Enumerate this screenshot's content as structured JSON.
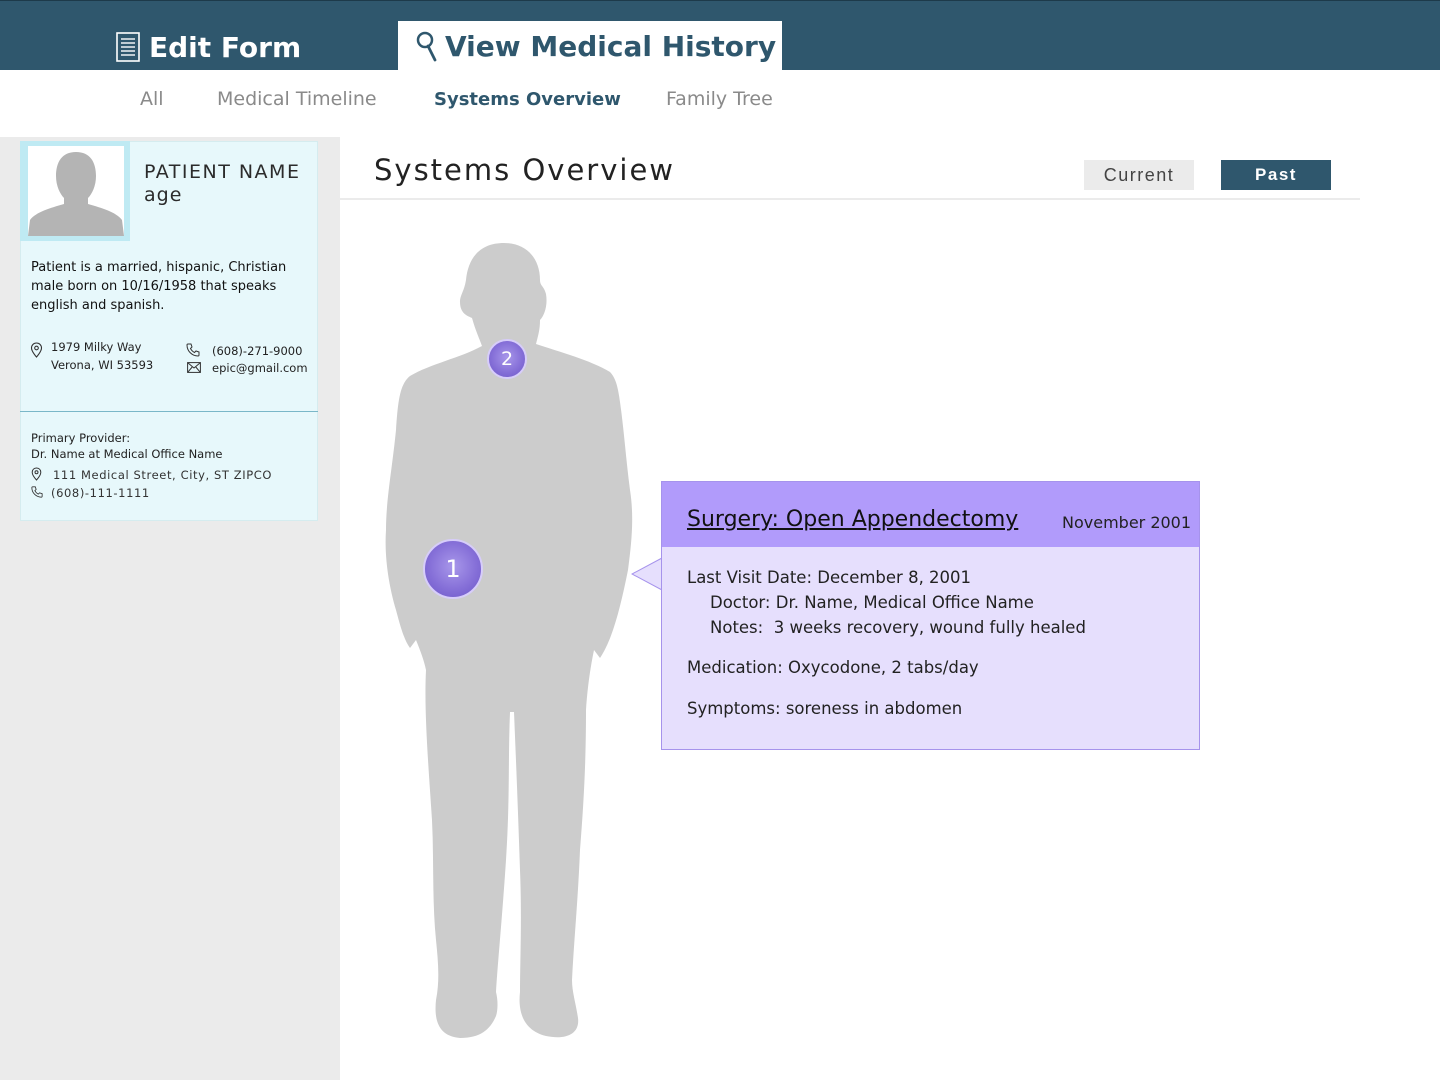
{
  "header": {
    "edit_form_label": "Edit Form",
    "view_history_label": "View Medical History"
  },
  "subnav": {
    "items": [
      "All",
      "Medical Timeline",
      "Systems Overview",
      "Family Tree"
    ],
    "active": "Systems Overview"
  },
  "patient": {
    "name": "PATIENT NAME",
    "age": "age",
    "bio": "Patient is a married, hispanic, Christian male born on 10/16/1958 that speaks english and spanish.",
    "address_line1": "1979 Milky Way",
    "address_line2": "Verona, WI 53593",
    "phone": "(608)-271-9000",
    "email": "epic@gmail.com",
    "provider_label": "Primary Provider:",
    "provider_name": "Dr. Name at Medical Office Name",
    "provider_address": "111 Medical Street, City, ST ZIPCO",
    "provider_phone": "(608)-111-1111"
  },
  "main": {
    "title": "Systems Overview",
    "current_label": "Current",
    "past_label": "Past",
    "selected_toggle": "Past"
  },
  "markers": [
    {
      "number": "1"
    },
    {
      "number": "2"
    }
  ],
  "popup": {
    "title": "Surgery: Open Appendectomy",
    "date": "November 2001",
    "last_visit": "Last Visit Date: December 8, 2001",
    "doctor": "Doctor: Dr. Name, Medical Office Name",
    "notes": "Notes:  3 weeks recovery, wound fully healed",
    "medication": "Medication: Oxycodone, 2 tabs/day",
    "symptoms": "Symptoms: soreness in abdomen"
  },
  "colors": {
    "header_bg": "#2f576d",
    "popup_header": "#b19bfb",
    "popup_body": "#e6dffd",
    "marker": "#8670d8",
    "card_bg": "#e7f8fb",
    "silhouette": "#cccccc"
  },
  "icons": {
    "edit_form": "document-icon",
    "view_history": "search-icon",
    "address": "location-pin-icon",
    "phone": "phone-icon",
    "email": "envelope-icon"
  }
}
